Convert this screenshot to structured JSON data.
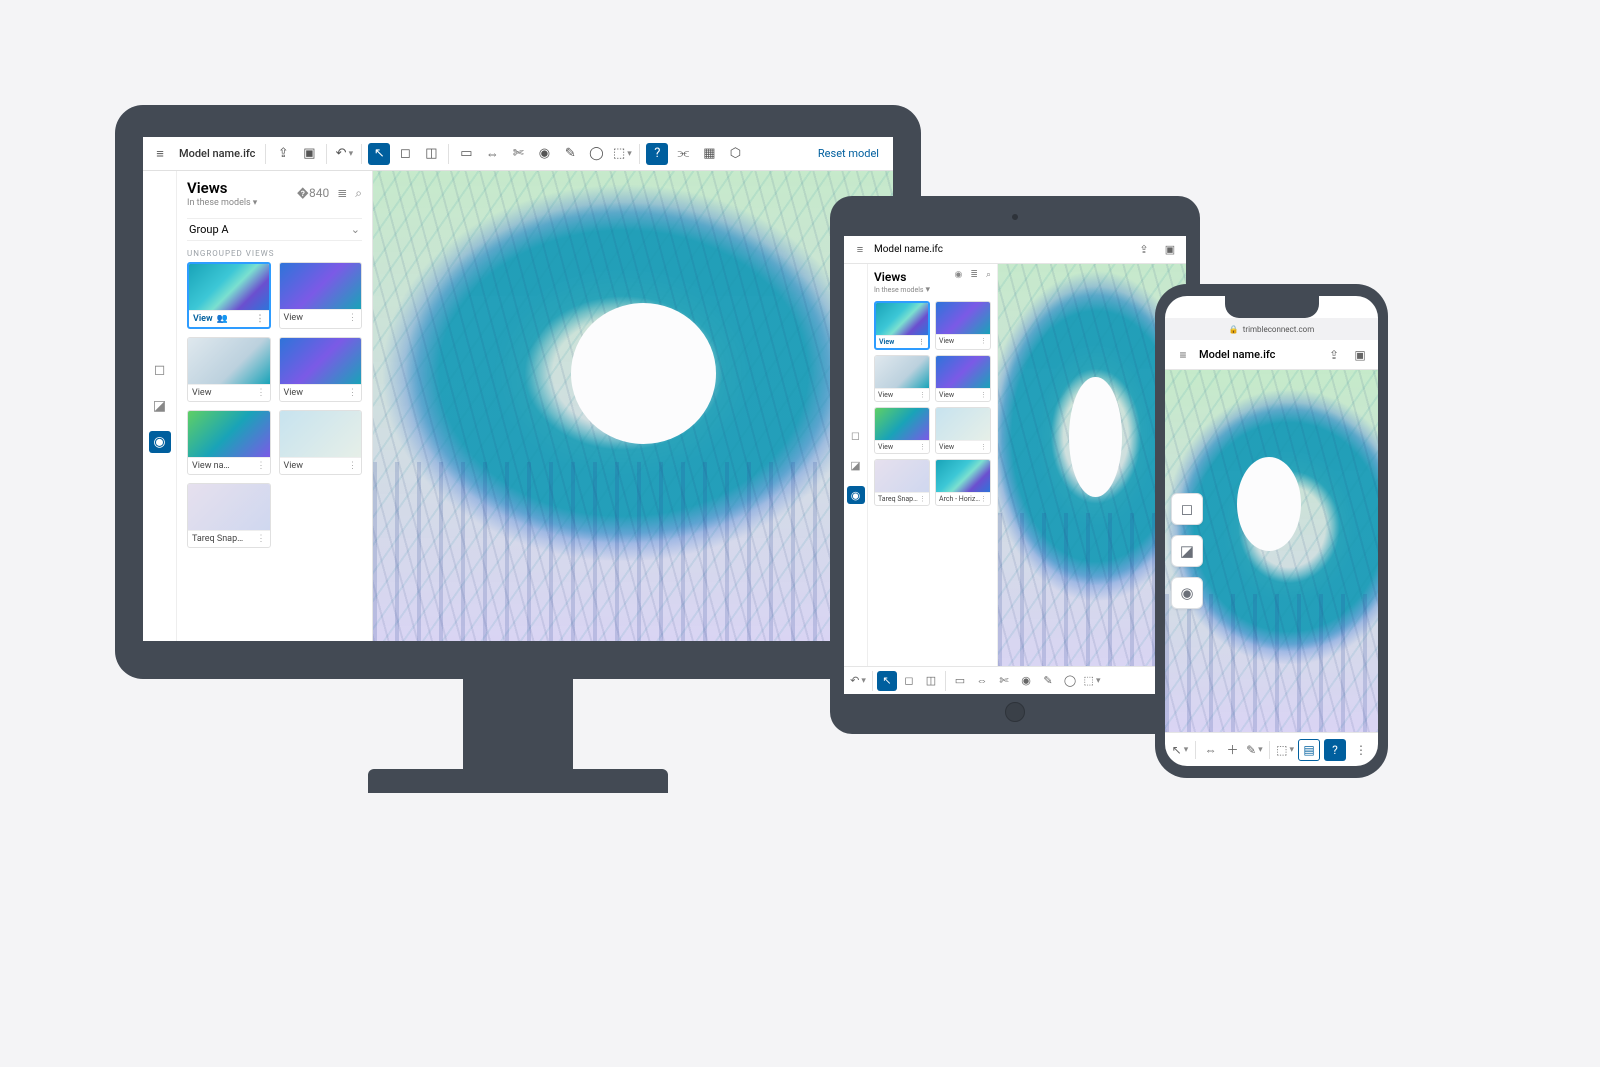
{
  "colors": {
    "accent": "#005f9e",
    "bezel": "#434a54"
  },
  "desktop": {
    "filename": "Model name.ifc",
    "reset_label": "Reset model",
    "views": {
      "title": "Views",
      "subtitle": "In these models",
      "group": "Group A",
      "section": "UNGROUPED VIEWS",
      "items": [
        {
          "label": "View",
          "selected": true,
          "shared": true
        },
        {
          "label": "View"
        },
        {
          "label": "View"
        },
        {
          "label": "View"
        },
        {
          "label": "View na…"
        },
        {
          "label": "View"
        },
        {
          "label": "Tareq Snap…"
        }
      ]
    }
  },
  "tablet": {
    "filename": "Model name.ifc",
    "views": {
      "title": "Views",
      "subtitle": "In these models",
      "items": [
        {
          "label": "View",
          "selected": true
        },
        {
          "label": "View"
        },
        {
          "label": "View"
        },
        {
          "label": "View"
        },
        {
          "label": "View"
        },
        {
          "label": "View"
        },
        {
          "label": "Tareq Snap…"
        },
        {
          "label": "Arch - Horiz…"
        }
      ]
    }
  },
  "phone": {
    "url": "trimbleconnect.com",
    "filename": "Model name.ifc"
  }
}
